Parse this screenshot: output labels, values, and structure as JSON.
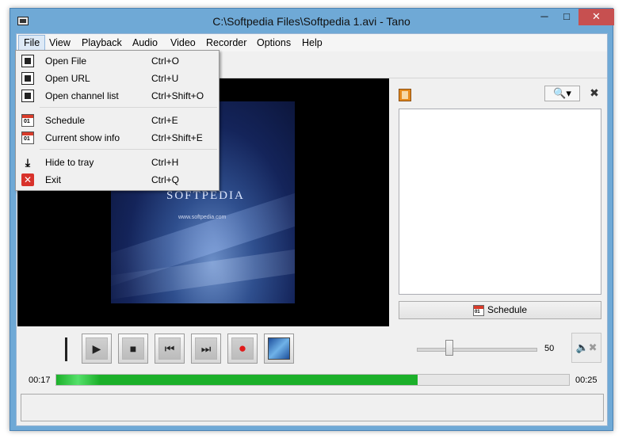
{
  "window": {
    "title": "C:\\Softpedia Files\\Softpedia 1.avi - Tano",
    "min_glyph": "─",
    "max_glyph": "□",
    "close_glyph": "✕"
  },
  "menubar": {
    "items": [
      "File",
      "View",
      "Playback",
      "Audio",
      "Video",
      "Recorder",
      "Options",
      "Help"
    ],
    "active": "File"
  },
  "file_menu": {
    "items": [
      {
        "label": "Open File",
        "shortcut": "Ctrl+O",
        "icon": "document-icon"
      },
      {
        "label": "Open URL",
        "shortcut": "Ctrl+U",
        "icon": "document-icon"
      },
      {
        "label": "Open channel list",
        "shortcut": "Ctrl+Shift+O",
        "icon": "document-icon"
      },
      {
        "label": "Schedule",
        "shortcut": "Ctrl+E",
        "icon": "calendar-icon"
      },
      {
        "label": "Current show info",
        "shortcut": "Ctrl+Shift+E",
        "icon": "calendar-icon"
      },
      {
        "label": "Hide to tray",
        "shortcut": "Ctrl+H",
        "icon": "download-tray-icon"
      },
      {
        "label": "Exit",
        "shortcut": "Ctrl+Q",
        "icon": "exit-icon"
      }
    ]
  },
  "video": {
    "poster_logo": "SOFTPEDIA",
    "poster_url": "www.softpedia.com"
  },
  "side_panel": {
    "search_glyph": "🔍▾",
    "close_glyph": "✖",
    "schedule_label": "Schedule",
    "calendar_day": "01"
  },
  "controls": {
    "buttons": [
      {
        "name": "play-button",
        "glyph": "▶"
      },
      {
        "name": "stop-button",
        "glyph": "■"
      },
      {
        "name": "previous-button",
        "glyph": "⏮"
      },
      {
        "name": "next-button",
        "glyph": "⏭"
      },
      {
        "name": "record-button",
        "glyph": "●"
      },
      {
        "name": "snapshot-button",
        "glyph": ""
      }
    ],
    "volume": 50,
    "volume_label": "50",
    "mute_glyph": "🔈✖"
  },
  "progress": {
    "current_time": "00:17",
    "total_time": "00:25",
    "fraction": 0.705
  },
  "colors": {
    "progress": "#1cb02a",
    "accent": "#6fa9d6",
    "close": "#c75050"
  }
}
